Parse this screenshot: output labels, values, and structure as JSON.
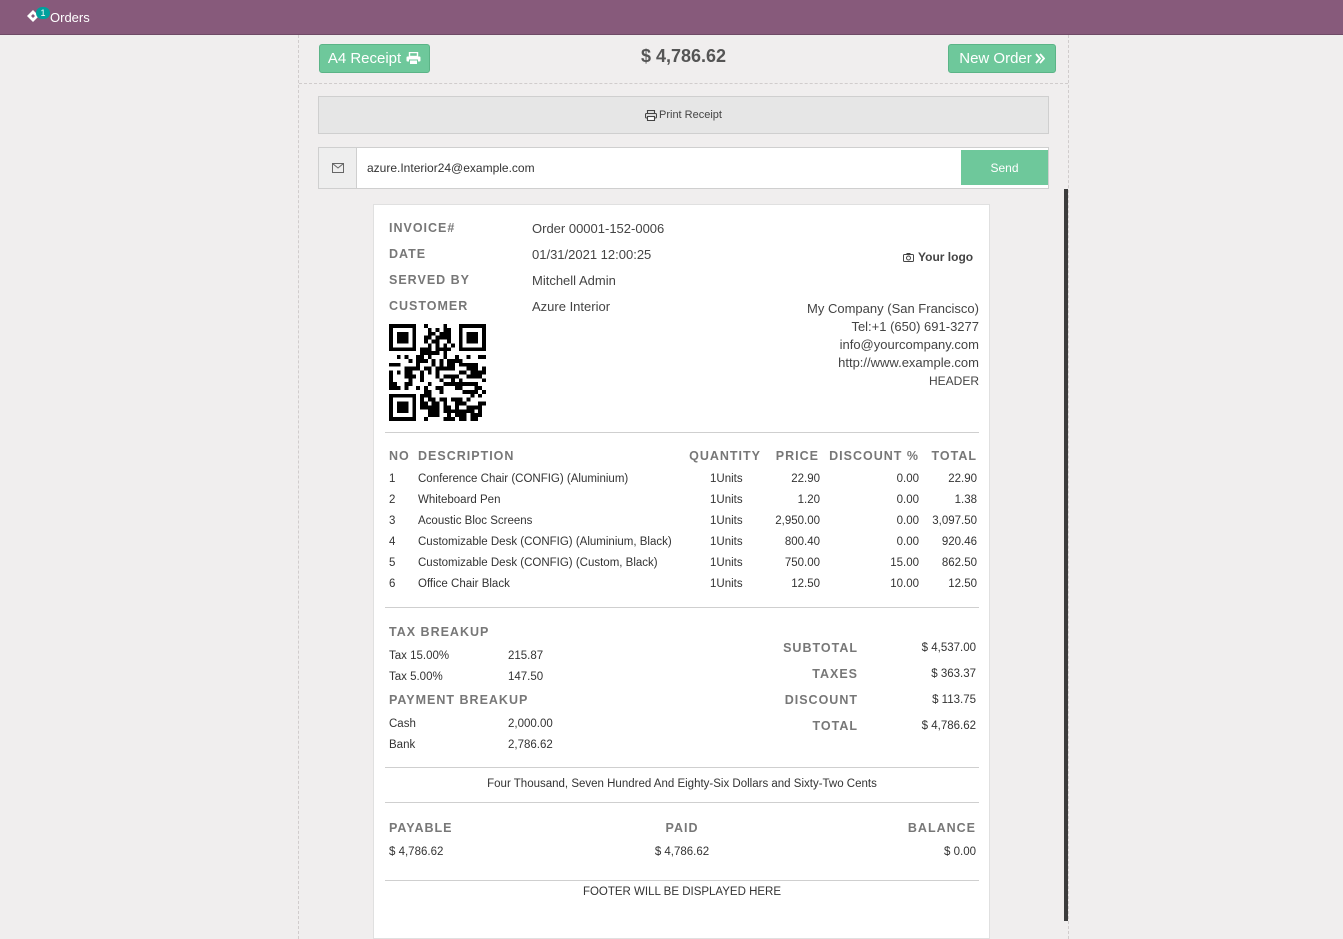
{
  "topbar": {
    "orders_label": "Orders",
    "orders_badge": "1"
  },
  "header": {
    "a4_receipt_label": "A4 Receipt",
    "total": "$ 4,786.62",
    "new_order_label": "New Order"
  },
  "print": {
    "label": "Print Receipt"
  },
  "email": {
    "value": "azure.Interior24@example.com",
    "send_label": "Send"
  },
  "receipt": {
    "labels": {
      "invoice": "INVOICE#",
      "date": "DATE",
      "served_by": "SERVED BY",
      "customer": "CUSTOMER"
    },
    "invoice": "Order 00001-152-0006",
    "date": "01/31/2021 12:00:25",
    "served_by": "Mitchell Admin",
    "customer": "Azure Interior",
    "logo_text": "Your logo",
    "company": {
      "name": "My Company (San Francisco)",
      "tel": "Tel:+1 (650) 691-3277",
      "email": "info@yourcompany.com",
      "web": "http://www.example.com",
      "header": "HEADER"
    },
    "columns": {
      "no": "NO",
      "description": "DESCRIPTION",
      "quantity": "QUANTITY",
      "price": "PRICE",
      "discount": "DISCOUNT %",
      "total": "TOTAL"
    },
    "lines": [
      {
        "no": "1",
        "description": "Conference Chair (CONFIG) (Aluminium)",
        "quantity": "1Units",
        "price": "22.90",
        "discount": "0.00",
        "total": "22.90"
      },
      {
        "no": "2",
        "description": "Whiteboard Pen",
        "quantity": "1Units",
        "price": "1.20",
        "discount": "0.00",
        "total": "1.38"
      },
      {
        "no": "3",
        "description": "Acoustic Bloc Screens",
        "quantity": "1Units",
        "price": "2,950.00",
        "discount": "0.00",
        "total": "3,097.50"
      },
      {
        "no": "4",
        "description": "Customizable Desk (CONFIG) (Aluminium, Black)",
        "quantity": "1Units",
        "price": "800.40",
        "discount": "0.00",
        "total": "920.46"
      },
      {
        "no": "5",
        "description": "Customizable Desk (CONFIG) (Custom, Black)",
        "quantity": "1Units",
        "price": "750.00",
        "discount": "15.00",
        "total": "862.50"
      },
      {
        "no": "6",
        "description": "Office Chair Black",
        "quantity": "1Units",
        "price": "12.50",
        "discount": "10.00",
        "total": "12.50"
      }
    ],
    "tax_breakup": {
      "title": "TAX BREAKUP",
      "rows": [
        {
          "label": "Tax 15.00%",
          "value": "215.87"
        },
        {
          "label": "Tax 5.00%",
          "value": "147.50"
        }
      ]
    },
    "payment_breakup": {
      "title": "PAYMENT BREAKUP",
      "rows": [
        {
          "label": "Cash",
          "value": "2,000.00"
        },
        {
          "label": "Bank",
          "value": "2,786.62"
        }
      ]
    },
    "summary": {
      "subtotal_label": "SUBTOTAL",
      "subtotal": "$ 4,537.00",
      "taxes_label": "TAXES",
      "taxes": "$ 363.37",
      "discount_label": "DISCOUNT",
      "discount": "$ 113.75",
      "total_label": "TOTAL",
      "total": "$ 4,786.62"
    },
    "amount_words": "Four Thousand, Seven Hundred And Eighty-Six Dollars and Sixty-Two Cents",
    "footer_totals": {
      "payable_label": "PAYABLE",
      "payable": "$ 4,786.62",
      "paid_label": "PAID",
      "paid": "$ 4,786.62",
      "balance_label": "BALANCE",
      "balance": "$ 0.00"
    },
    "footer": "FOOTER WILL BE DISPLAYED HERE"
  },
  "icons": {
    "orders": "ticket-icon",
    "a4": "printer-icon",
    "new_order": "double-chevron-right-icon",
    "print": "printer-icon",
    "email": "envelope-icon",
    "logo": "camera-icon"
  },
  "colors": {
    "topbar": "#875a7b",
    "primary_button": "#6ec89b",
    "badge": "#00a09d"
  }
}
